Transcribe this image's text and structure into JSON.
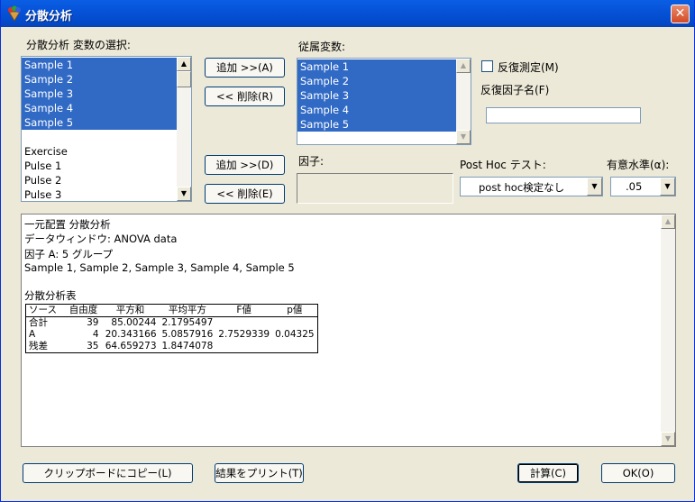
{
  "window": {
    "title": "分散分析",
    "close_glyph": "✕"
  },
  "left_panel": {
    "label": "分散分析 変数の選択:",
    "variables": [
      {
        "label": "Sample 1",
        "selected": true
      },
      {
        "label": "Sample 2",
        "selected": true
      },
      {
        "label": "Sample 3",
        "selected": true
      },
      {
        "label": "Sample 4",
        "selected": true
      },
      {
        "label": "Sample 5",
        "selected": true
      },
      {
        "label": "",
        "selected": false
      },
      {
        "label": "Exercise",
        "selected": false
      },
      {
        "label": "Pulse 1",
        "selected": false
      },
      {
        "label": "Pulse 2",
        "selected": false
      },
      {
        "label": "Pulse 3",
        "selected": false
      }
    ]
  },
  "buttons": {
    "add_dependent": "追加 >>(A)",
    "remove_dependent": "<< 削除(R)",
    "add_factor": "追加 >>(D)",
    "remove_factor": "<< 削除(E)",
    "copy_clipboard": "クリップボードにコピー(L)",
    "print_results": "結果をプリント(T)",
    "calculate": "計算(C)",
    "ok": "OK(O)"
  },
  "dependent": {
    "label": "従属変数:",
    "items": [
      "Sample 1",
      "Sample 2",
      "Sample 3",
      "Sample 4",
      "Sample 5"
    ]
  },
  "repeated": {
    "checkbox_label": "反復測定(M)",
    "checked": false,
    "factor_name_label": "反復因子名(F)",
    "factor_name_value": ""
  },
  "factor": {
    "label": "因子:"
  },
  "post_hoc": {
    "label": "Post Hoc テスト:",
    "value": "post hoc検定なし"
  },
  "alpha": {
    "label": "有意水準(α):",
    "value": ".05"
  },
  "results": {
    "lines": [
      "一元配置 分散分析",
      "データウィンドウ: ANOVA data",
      "因子 A: 5 グループ",
      "Sample 1,  Sample 2,  Sample 3,  Sample 4,  Sample 5"
    ],
    "table_title": "分散分析表",
    "table": {
      "headers": [
        "ソース",
        "自由度",
        "平方和",
        "平均平方",
        "F値",
        "p値"
      ],
      "rows": [
        [
          "合計",
          "39",
          "85.00244",
          "2.1795497",
          "",
          ""
        ],
        [
          "A",
          "4",
          "20.343166",
          "5.0857916",
          "2.7529339",
          "0.04325"
        ],
        [
          "残差",
          "35",
          "64.659273",
          "1.8474078",
          "",
          ""
        ]
      ]
    }
  }
}
